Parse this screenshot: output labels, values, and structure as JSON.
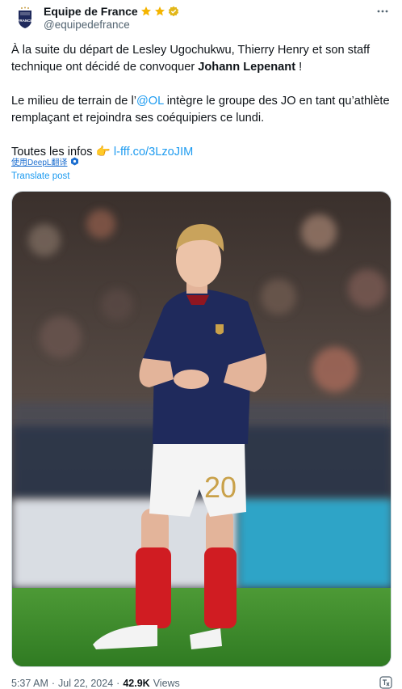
{
  "account": {
    "display_name": "Equipe de France",
    "handle": "@equipedefrance",
    "avatar_text": "FRANCE"
  },
  "post": {
    "line1": "À la suite du départ de Lesley Ugochukwu, Thierry Henry et son staff technique ont décidé de convoquer ",
    "bold_name": "Johann Lepenant",
    "line1_end": " !",
    "line2_start": "Le milieu de terrain de l’",
    "mention": "@OL",
    "line2_end": " intègre le groupe des JO en tant qu’athlète remplaçant et rejoindra ses coéquipiers ce lundi.",
    "line3_start": "Toutes les infos ",
    "emoji": "👉",
    "link": "l-fff.co/3LzoJIM"
  },
  "deepl_label": "使用DeepL翻译",
  "translate_label": "Translate post",
  "photo": {
    "jersey_number": "20"
  },
  "meta": {
    "time": "5:37 AM",
    "separator": "·",
    "date": "Jul 22, 2024",
    "views_count": "42.9K",
    "views_label": "Views"
  },
  "colors": {
    "link": "#1d9bf0",
    "muted": "#536471",
    "jersey": "#1f2a5c",
    "pitch": "#3f8a2c",
    "socks": "#d01c22"
  }
}
